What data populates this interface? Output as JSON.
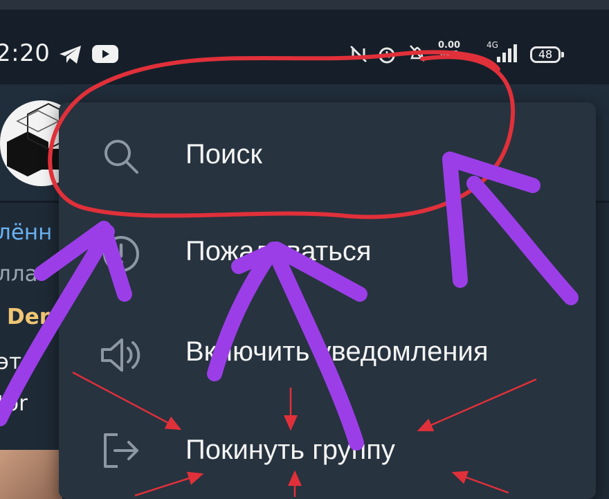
{
  "status_bar": {
    "time": "2:20",
    "network_speed_value": "0.00",
    "network_speed_unit": "KB/S",
    "signal_label": "4G",
    "battery_level": "48",
    "left_icons": [
      "telegram-icon",
      "youtube-icon"
    ],
    "right_icons": [
      "nfc-icon",
      "alarm-icon",
      "do-not-disturb-icon",
      "signal-icon",
      "battery-icon"
    ]
  },
  "chat_background": {
    "rows": [
      {
        "text": "лённ",
        "color": "#6ab3f3"
      },
      {
        "text": "лла",
        "color": "#9aa6b2"
      },
      {
        "text": "Der",
        "color": "#f0c674"
      },
      {
        "text": "это",
        "color": "#f0f0f0"
      },
      {
        "text": "tor",
        "color": "#f0f0f0"
      }
    ]
  },
  "menu": {
    "items": [
      {
        "label": "Поиск",
        "icon": "search-icon"
      },
      {
        "label": "Пожаловаться",
        "icon": "report-icon"
      },
      {
        "label": "Включить уведомления",
        "icon": "speaker-icon"
      },
      {
        "label": "Покинуть группу",
        "icon": "leave-icon"
      }
    ]
  },
  "annotations": {
    "circle_color": "#e0303a",
    "purple_arrow_color": "#9b3ee8",
    "red_arrow_color": "#e0303a"
  }
}
